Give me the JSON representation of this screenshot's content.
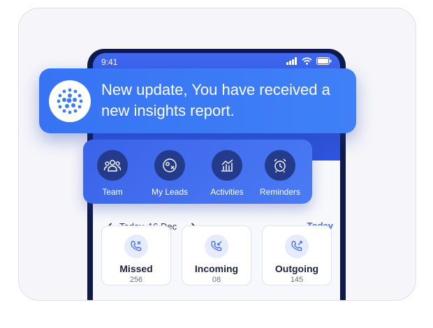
{
  "status_bar": {
    "time": "9:41"
  },
  "notification": {
    "text": "New update, You have received a new insights report."
  },
  "quick_actions": [
    {
      "label": "Team",
      "icon": "team-icon"
    },
    {
      "label": "My Leads",
      "icon": "leads-icon"
    },
    {
      "label": "Activities",
      "icon": "activities-chart-icon"
    },
    {
      "label": "Reminders",
      "icon": "alarm-clock-icon"
    }
  ],
  "date_nav": {
    "date": "Today, 16 Dec",
    "today_label": "Today"
  },
  "call_stats": [
    {
      "label": "Missed",
      "count": "256",
      "icon": "missed-call-icon"
    },
    {
      "label": "Incoming",
      "count": "08",
      "icon": "incoming-call-icon"
    },
    {
      "label": "Outgoing",
      "count": "145",
      "icon": "outgoing-call-icon"
    }
  ],
  "colors": {
    "accent": "#3c6be9",
    "phone_frame": "#0d1b4c",
    "notification_bg": "#3773f3"
  }
}
